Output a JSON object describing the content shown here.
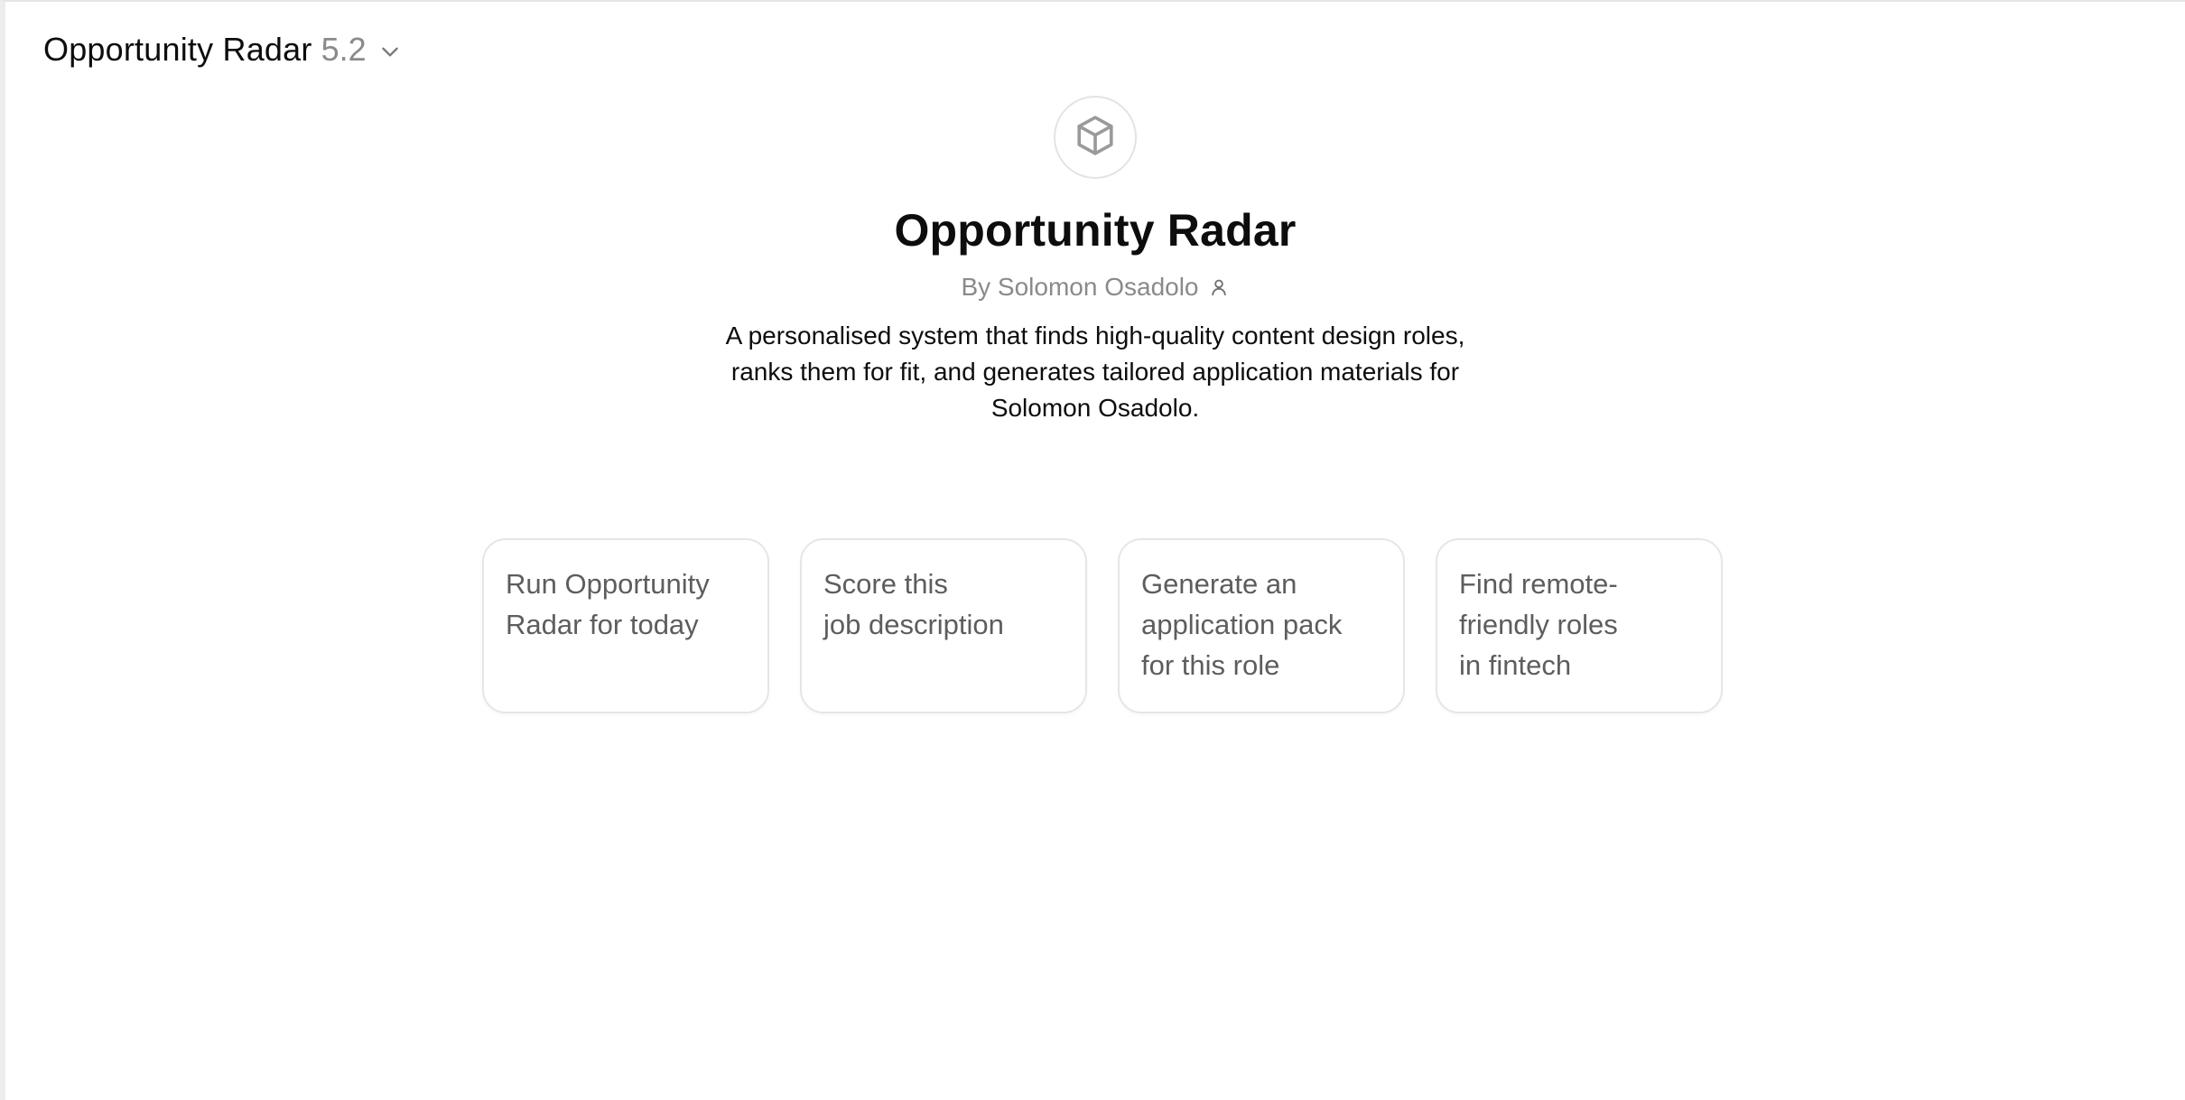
{
  "header": {
    "model_name": "Opportunity Radar",
    "model_version": "5.2",
    "dropdown_icon": "chevron-down-icon"
  },
  "profile": {
    "avatar_icon": "cube-icon",
    "title": "Opportunity Radar",
    "author": "By Solomon Osadolo",
    "author_icon": "person-icon",
    "description_lines": [
      "A personalised system that finds high-quality content design roles,",
      "ranks them for fit, and generates tailored application materials for",
      "Solomon Osadolo."
    ]
  },
  "starters": [
    {
      "lines": [
        "Run Opportunity",
        "Radar for today"
      ]
    },
    {
      "lines": [
        "Score this",
        "job description"
      ]
    },
    {
      "lines": [
        "Generate an",
        "application pack",
        "for this role"
      ]
    },
    {
      "lines": [
        "Find remote-",
        "friendly roles",
        "in fintech"
      ]
    }
  ],
  "colors": {
    "text_primary": "#0d0d0d",
    "text_secondary": "#8a8a8a",
    "card_text": "#5d5d5d",
    "border": "#e6e6e6"
  }
}
